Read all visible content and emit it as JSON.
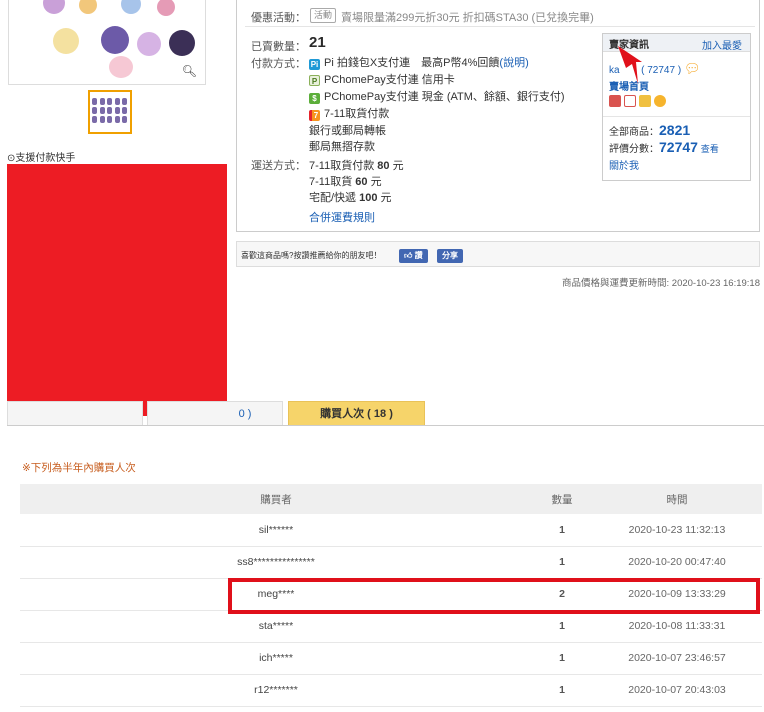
{
  "promo": {
    "label": "優惠活動：",
    "tag": "活動",
    "text": "賣場限量滿299元折30元 折扣碼STA30 (已兌換完畢)"
  },
  "sale": {
    "sold_label": "已賣數量：",
    "sold_count": "21",
    "payment_label": "付款方式：",
    "payments": [
      {
        "icon": "pi-icon",
        "text": "Pi 拍錢包X支付連　最高P幣4%回饋",
        "link": "(說明)"
      },
      {
        "icon": "pchomepay-icon",
        "text": "PChomePay支付連 信用卡",
        "link": ""
      },
      {
        "icon": "pchomepay-cash-icon",
        "text": "PChomePay支付連 現金 (ATM、餘額、銀行支付)",
        "link": ""
      },
      {
        "icon": "seven-eleven-icon",
        "text": "7-11取貨付款",
        "link": ""
      }
    ],
    "payments_extra": [
      "銀行或郵局轉帳",
      "郵局無摺存款"
    ],
    "shipping_label": "運送方式：",
    "shipping": [
      {
        "name": "7-11取貨付款",
        "price": "80",
        "unit": "元"
      },
      {
        "name": "7-11取貨",
        "price": "60",
        "unit": "元"
      },
      {
        "name": "宅配/快遞",
        "price": "100",
        "unit": "元"
      }
    ],
    "shipping_rule_link": "合併運費規則"
  },
  "seller": {
    "header": "賣家資訊",
    "add_fav": "加入最愛",
    "name": "ka",
    "name_suffix": "( 72747 )",
    "store_link": "賣場首頁",
    "all_items_label": "全部商品：",
    "all_items": "2821",
    "rating_label": "評價分數：",
    "rating": "72747",
    "rating_link": "查看",
    "about_link": "關於我"
  },
  "share": {
    "text": "喜歡這商品嗎?按讚推薦給你的朋友吧！",
    "like": "讚",
    "share": "分享"
  },
  "update_time": "商品價格與運費更新時間: 2020-10-23 16:19:18",
  "left": {
    "support_link": "支援付款快手"
  },
  "tabs": [
    {
      "label": ""
    },
    {
      "label": "0 )"
    },
    {
      "label": "購買人次 ( 18 )"
    }
  ],
  "note": "※下列為半年內購買人次",
  "table": {
    "headers": [
      "購買者",
      "數量",
      "時間"
    ],
    "rows": [
      {
        "buyer": "sil******",
        "qty": "1",
        "time": "2020-10-23 11:32:13"
      },
      {
        "buyer": "ss8***************",
        "qty": "1",
        "time": "2020-10-20 00:47:40"
      },
      {
        "buyer": "meg****",
        "qty": "2",
        "time": "2020-10-09 13:33:29"
      },
      {
        "buyer": "sta*****",
        "qty": "1",
        "time": "2020-10-08 11:33:31"
      },
      {
        "buyer": "ich*****",
        "qty": "1",
        "time": "2020-10-07 23:46:57"
      },
      {
        "buyer": "r12*******",
        "qty": "1",
        "time": "2020-10-07 20:43:03"
      }
    ]
  },
  "colors": {
    "accent_link": "#1a5fb4",
    "redaction": "#ed1c24",
    "highlight_box": "#e0101a",
    "active_tab": "#f6d46a",
    "note": "#c75d1e"
  }
}
